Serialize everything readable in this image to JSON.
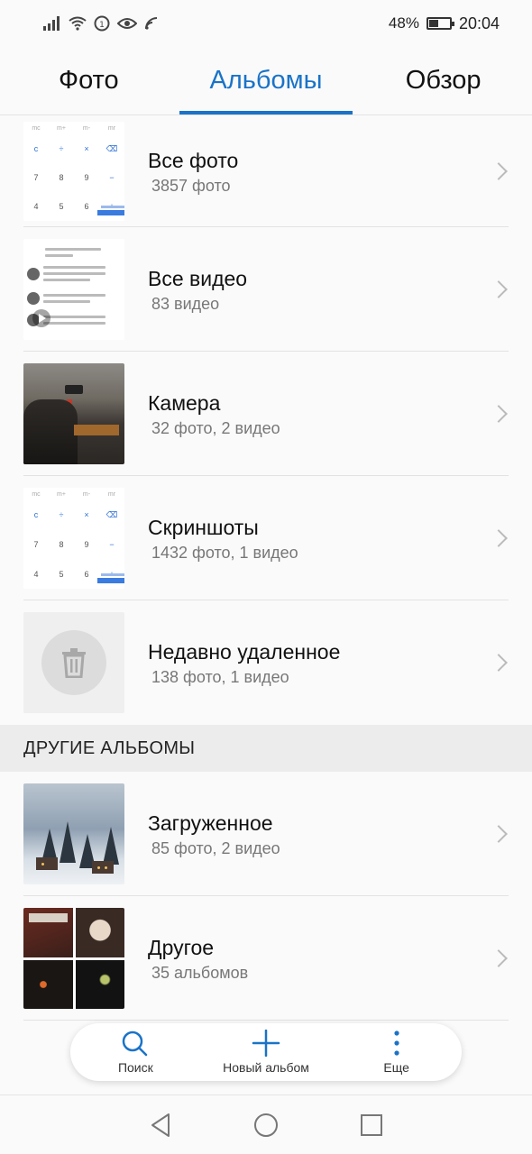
{
  "status_bar": {
    "battery": "48%",
    "time": "20:04"
  },
  "tabs": [
    {
      "label": "Фото",
      "active": false
    },
    {
      "label": "Альбомы",
      "active": true
    },
    {
      "label": "Обзор",
      "active": false
    }
  ],
  "albums": [
    {
      "title": "Все фото",
      "subtitle": "3857 фото"
    },
    {
      "title": "Все видео",
      "subtitle": "83 видео"
    },
    {
      "title": "Камера",
      "subtitle": "32 фото,  2 видео"
    },
    {
      "title": "Скриншоты",
      "subtitle": "1432 фото,  1 видео"
    },
    {
      "title": "Недавно удаленное",
      "subtitle": "138 фото,  1 видео"
    }
  ],
  "other_section": {
    "header": "ДРУГИЕ АЛЬБОМЫ",
    "albums": [
      {
        "title": "Загруженное",
        "subtitle": "85 фото,  2 видео"
      },
      {
        "title": "Другое",
        "subtitle": "35 альбомов"
      }
    ]
  },
  "toolbar": {
    "search_label": "Поиск",
    "new_album_label": "Новый альбом",
    "more_label": "Еще"
  },
  "colors": {
    "accent": "#1a73c8"
  }
}
